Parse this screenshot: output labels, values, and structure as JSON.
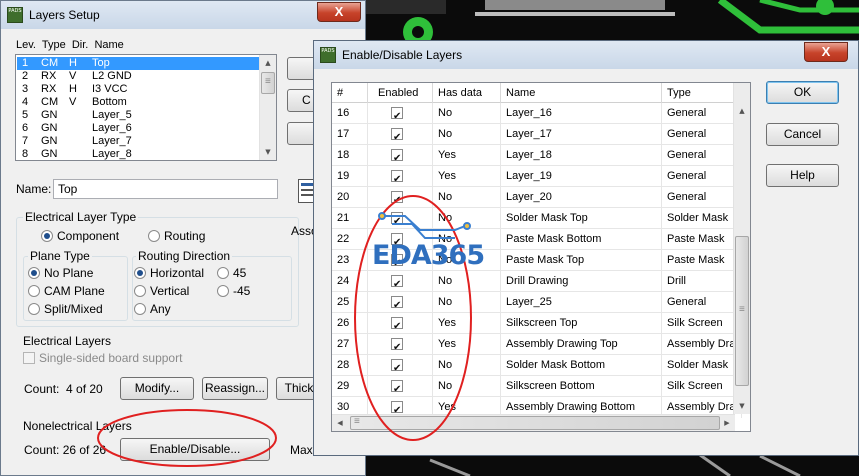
{
  "colors": {
    "accent": "#3399ff",
    "annotation": "#e02020",
    "pcb_copper": "#2fbf3a",
    "watermark": "#2f6fbe"
  },
  "layers_setup": {
    "title": "Layers Setup",
    "app_icon": "PADS",
    "close_label": "X",
    "list_header": "Lev.  Type  Dir.  Name",
    "layers": [
      {
        "lev": "1",
        "type": "CM",
        "dir": "H",
        "name": "Top"
      },
      {
        "lev": "2",
        "type": "RX",
        "dir": "V",
        "name": "L2 GND"
      },
      {
        "lev": "3",
        "type": "RX",
        "dir": "H",
        "name": "I3 VCC"
      },
      {
        "lev": "4",
        "type": "CM",
        "dir": "V",
        "name": "Bottom"
      },
      {
        "lev": "5",
        "type": "GN",
        "dir": "",
        "name": "Layer_5"
      },
      {
        "lev": "6",
        "type": "GN",
        "dir": "",
        "name": "Layer_6"
      },
      {
        "lev": "7",
        "type": "GN",
        "dir": "",
        "name": "Layer_7"
      },
      {
        "lev": "8",
        "type": "GN",
        "dir": "",
        "name": "Layer_8"
      }
    ],
    "name_label": "Name:",
    "name_value": "Top",
    "electrical_layer_type": "Electrical Layer Type",
    "component_label": "Component",
    "routing_label": "Routing",
    "plane_type": "Plane Type",
    "no_plane": "No Plane",
    "cam_plane": "CAM Plane",
    "split_mixed": "Split/Mixed",
    "routing_direction": "Routing Direction",
    "horizontal": "Horizontal",
    "vertical": "Vertical",
    "any": "Any",
    "deg45": "45",
    "deg_neg45": "-45",
    "electrical_layers": "Electrical Layers",
    "single_sided": "Single-sided board support",
    "count_electrical": "Count:  4 of 20",
    "modify_button": "Modify...",
    "reassign_button": "Reassign...",
    "thickness_button": "Thick",
    "nonelectrical_layers": "Nonelectrical Layers",
    "count_nonelectrical": "Count: 26 of 26",
    "enable_disable_button": "Enable/Disable...",
    "max_label": "Max",
    "partial_c": "C",
    "partial_assoc": "Asso"
  },
  "enable_disable": {
    "title": "Enable/Disable Layers",
    "app_icon": "PADS",
    "close_label": "X",
    "ok_button": "OK",
    "cancel_button": "Cancel",
    "help_button": "Help",
    "columns": [
      "#",
      "Enabled",
      "Has data",
      "Name",
      "Type"
    ],
    "rows": [
      {
        "num": "16",
        "enabled": true,
        "has_data": "No",
        "name": "Layer_16",
        "type": "General"
      },
      {
        "num": "17",
        "enabled": true,
        "has_data": "No",
        "name": "Layer_17",
        "type": "General"
      },
      {
        "num": "18",
        "enabled": true,
        "has_data": "Yes",
        "name": "Layer_18",
        "type": "General"
      },
      {
        "num": "19",
        "enabled": true,
        "has_data": "Yes",
        "name": "Layer_19",
        "type": "General"
      },
      {
        "num": "20",
        "enabled": true,
        "has_data": "No",
        "name": "Layer_20",
        "type": "General"
      },
      {
        "num": "21",
        "enabled": true,
        "has_data": "No",
        "name": "Solder Mask Top",
        "type": "Solder Mask"
      },
      {
        "num": "22",
        "enabled": true,
        "has_data": "No",
        "name": "Paste Mask Bottom",
        "type": "Paste Mask"
      },
      {
        "num": "23",
        "enabled": true,
        "has_data": "No",
        "name": "Paste Mask Top",
        "type": "Paste Mask"
      },
      {
        "num": "24",
        "enabled": true,
        "has_data": "No",
        "name": "Drill Drawing",
        "type": "Drill"
      },
      {
        "num": "25",
        "enabled": true,
        "has_data": "No",
        "name": "Layer_25",
        "type": "General"
      },
      {
        "num": "26",
        "enabled": true,
        "has_data": "Yes",
        "name": "Silkscreen Top",
        "type": "Silk Screen"
      },
      {
        "num": "27",
        "enabled": true,
        "has_data": "Yes",
        "name": "Assembly Drawing Top",
        "type": "Assembly Draw"
      },
      {
        "num": "28",
        "enabled": true,
        "has_data": "No",
        "name": "Solder Mask Bottom",
        "type": "Solder Mask"
      },
      {
        "num": "29",
        "enabled": true,
        "has_data": "No",
        "name": "Silkscreen Bottom",
        "type": "Silk Screen"
      },
      {
        "num": "30",
        "enabled": true,
        "has_data": "Yes",
        "name": "Assembly Drawing Bottom",
        "type": "Assembly Draw"
      }
    ]
  },
  "watermark": "EDA365"
}
